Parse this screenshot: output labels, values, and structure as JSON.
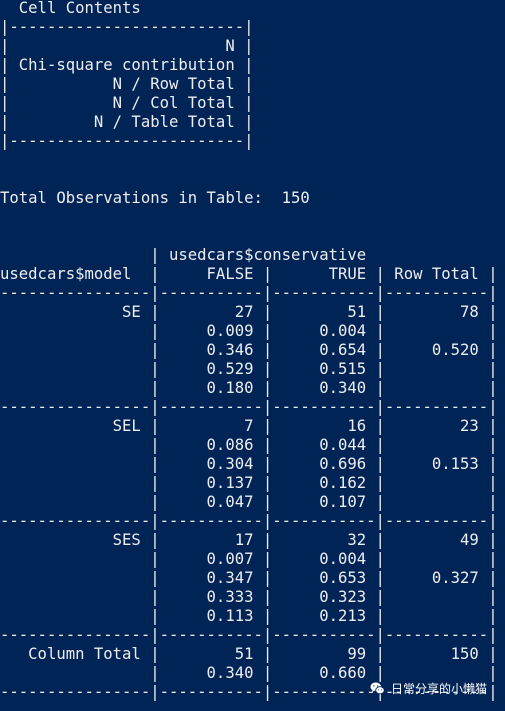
{
  "console": {
    "lines": [
      "  Cell Contents",
      "|-------------------------|",
      "|                       N |",
      "| Chi-square contribution |",
      "|           N / Row Total |",
      "|           N / Col Total |",
      "|         N / Table Total |",
      "|-------------------------|",
      "",
      "",
      "Total Observations in Table:  150",
      "",
      "",
      "                | usedcars$conservative",
      "usedcars$model  |     FALSE |      TRUE | Row Total |",
      "----------------|-----------|-----------|-----------|",
      "             SE |        27 |        51 |        78 |",
      "                |     0.009 |     0.004 |           |",
      "                |     0.346 |     0.654 |     0.520 |",
      "                |     0.529 |     0.515 |           |",
      "                |     0.180 |     0.340 |           |",
      "----------------|-----------|-----------|-----------|",
      "            SEL |         7 |        16 |        23 |",
      "                |     0.086 |     0.044 |           |",
      "                |     0.304 |     0.696 |     0.153 |",
      "                |     0.137 |     0.162 |           |",
      "                |     0.047 |     0.107 |           |",
      "----------------|-----------|-----------|-----------|",
      "            SES |        17 |        32 |        49 |",
      "                |     0.007 |     0.004 |           |",
      "                |     0.347 |     0.653 |     0.327 |",
      "                |     0.333 |     0.323 |           |",
      "                |     0.113 |     0.213 |           |",
      "----------------|-----------|-----------|-----------|",
      "   Column Total |        51 |        99 |       150 |",
      "                |     0.340 |     0.660 |           |",
      "----------------|-----------|-----------|-----------|"
    ]
  },
  "watermark": {
    "text": "日常分享的小懒猫",
    "icon": "wechat-icon"
  },
  "colors": {
    "background": "#012456",
    "foreground": "#eeedf0"
  }
}
